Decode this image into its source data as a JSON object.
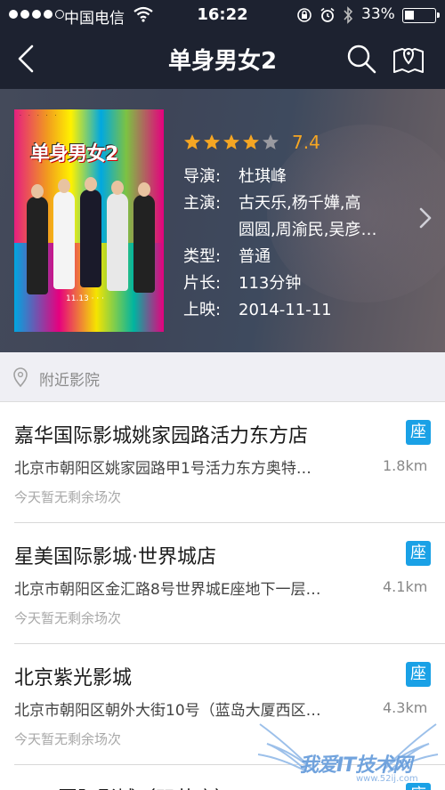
{
  "status_bar": {
    "carrier": "中国电信",
    "time": "16:22",
    "battery": "33%"
  },
  "nav": {
    "title": "单身男女2"
  },
  "movie": {
    "poster_title": "单身男女2",
    "rating": "7.4",
    "stars_filled": 4,
    "stars_total": 5,
    "director_label": "导演:",
    "director": "杜琪峰",
    "cast_label": "主演:",
    "cast_line1": "古天乐,杨千嬅,高",
    "cast_line2": "圆圆,周渝民,吴彦…",
    "type_label": "类型:",
    "type": "普通",
    "length_label": "片长:",
    "length": "113分钟",
    "release_label": "上映:",
    "release": "2014-11-11"
  },
  "section": {
    "label": "附近影院"
  },
  "cinemas": [
    {
      "name": "嘉华国际影城姚家园路活力东方店",
      "badge": "座",
      "address": "北京市朝阳区姚家园路甲1号活力东方奥特…",
      "distance": "1.8km",
      "status": "今天暂无剩余场次"
    },
    {
      "name": "星美国际影城·世界城店",
      "badge": "座",
      "address": "北京市朝阳区金汇路8号世界城E座地下一层…",
      "distance": "4.1km",
      "status": "今天暂无剩余场次"
    },
    {
      "name": "北京紫光影城",
      "badge": "座",
      "address": "北京市朝阳区朝外大街10号（蓝岛大厦西区…",
      "distance": "4.3km",
      "status": "今天暂无剩余场次"
    },
    {
      "name": "UME国际影城（双井店）",
      "badge": "座"
    }
  ],
  "watermark": {
    "text": "我爱IT技术网",
    "url": "www.52ij.com"
  },
  "colors": {
    "header_bg": "#1d2230",
    "accent_star": "#f5a623",
    "seat_badge": "#1aa1e6"
  },
  "icons": [
    "back-chevron-icon",
    "search-icon",
    "map-pin-icon",
    "chevron-right-icon",
    "location-pin-icon",
    "star-icon",
    "wifi-icon",
    "alarm-icon",
    "bluetooth-icon",
    "orientation-lock-icon"
  ]
}
